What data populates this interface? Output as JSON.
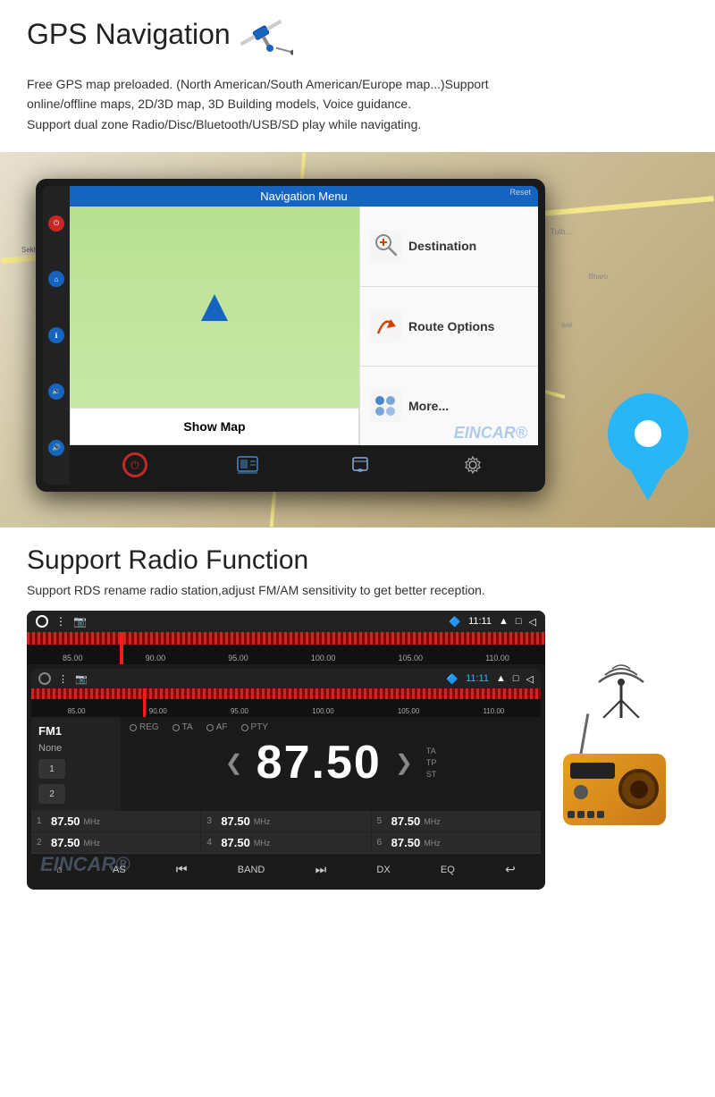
{
  "gps": {
    "title": "GPS Navigation",
    "description": "Free GPS map preloaded. (North American/South American/Europe map...)Support\nonline/offline maps, 2D/3D map, 3D Building models, Voice guidance.\nSupport dual zone Radio/Disc/Bluetooth/USB/SD play while navigating.",
    "screen_title": "Navigation Menu",
    "reset_label": "Reset",
    "map_section": {
      "show_map": "Show Map"
    },
    "nav_menu": {
      "destination": "Destination",
      "route_options": "Route Options",
      "more": "More..."
    },
    "watermark": "EINCAR®"
  },
  "radio": {
    "title": "Support Radio Function",
    "description": "Support RDS rename radio station,adjust FM/AM sensitivity to get better reception.",
    "status_time": "11:11",
    "fm_label": "FM1",
    "fm_station": "None",
    "frequency": "87.50",
    "modes": [
      "REG",
      "TA",
      "AF",
      "PTY"
    ],
    "rds_labels": [
      "TA",
      "TP",
      "ST"
    ],
    "freq_range": [
      "85.00",
      "90.00",
      "95.00",
      "100.00",
      "105.00",
      "110.00"
    ],
    "presets": [
      {
        "num": "1",
        "freq": "87.50",
        "mhz": "MHz"
      },
      {
        "num": "3",
        "freq": "87.50",
        "mhz": "MHz"
      },
      {
        "num": "5",
        "freq": "87.50",
        "mhz": "MHz"
      },
      {
        "num": "2",
        "freq": "87.50",
        "mhz": "MHz"
      },
      {
        "num": "4",
        "freq": "87.50",
        "mhz": "MHz"
      },
      {
        "num": "6",
        "freq": "87.50",
        "mhz": "MHz"
      }
    ],
    "controls": [
      "AS",
      "◀◀",
      "BAND",
      "▶▶",
      "DX",
      "EQ"
    ],
    "home_label": "⌂",
    "back_label": "↩",
    "watermark": "EINCAR®"
  }
}
